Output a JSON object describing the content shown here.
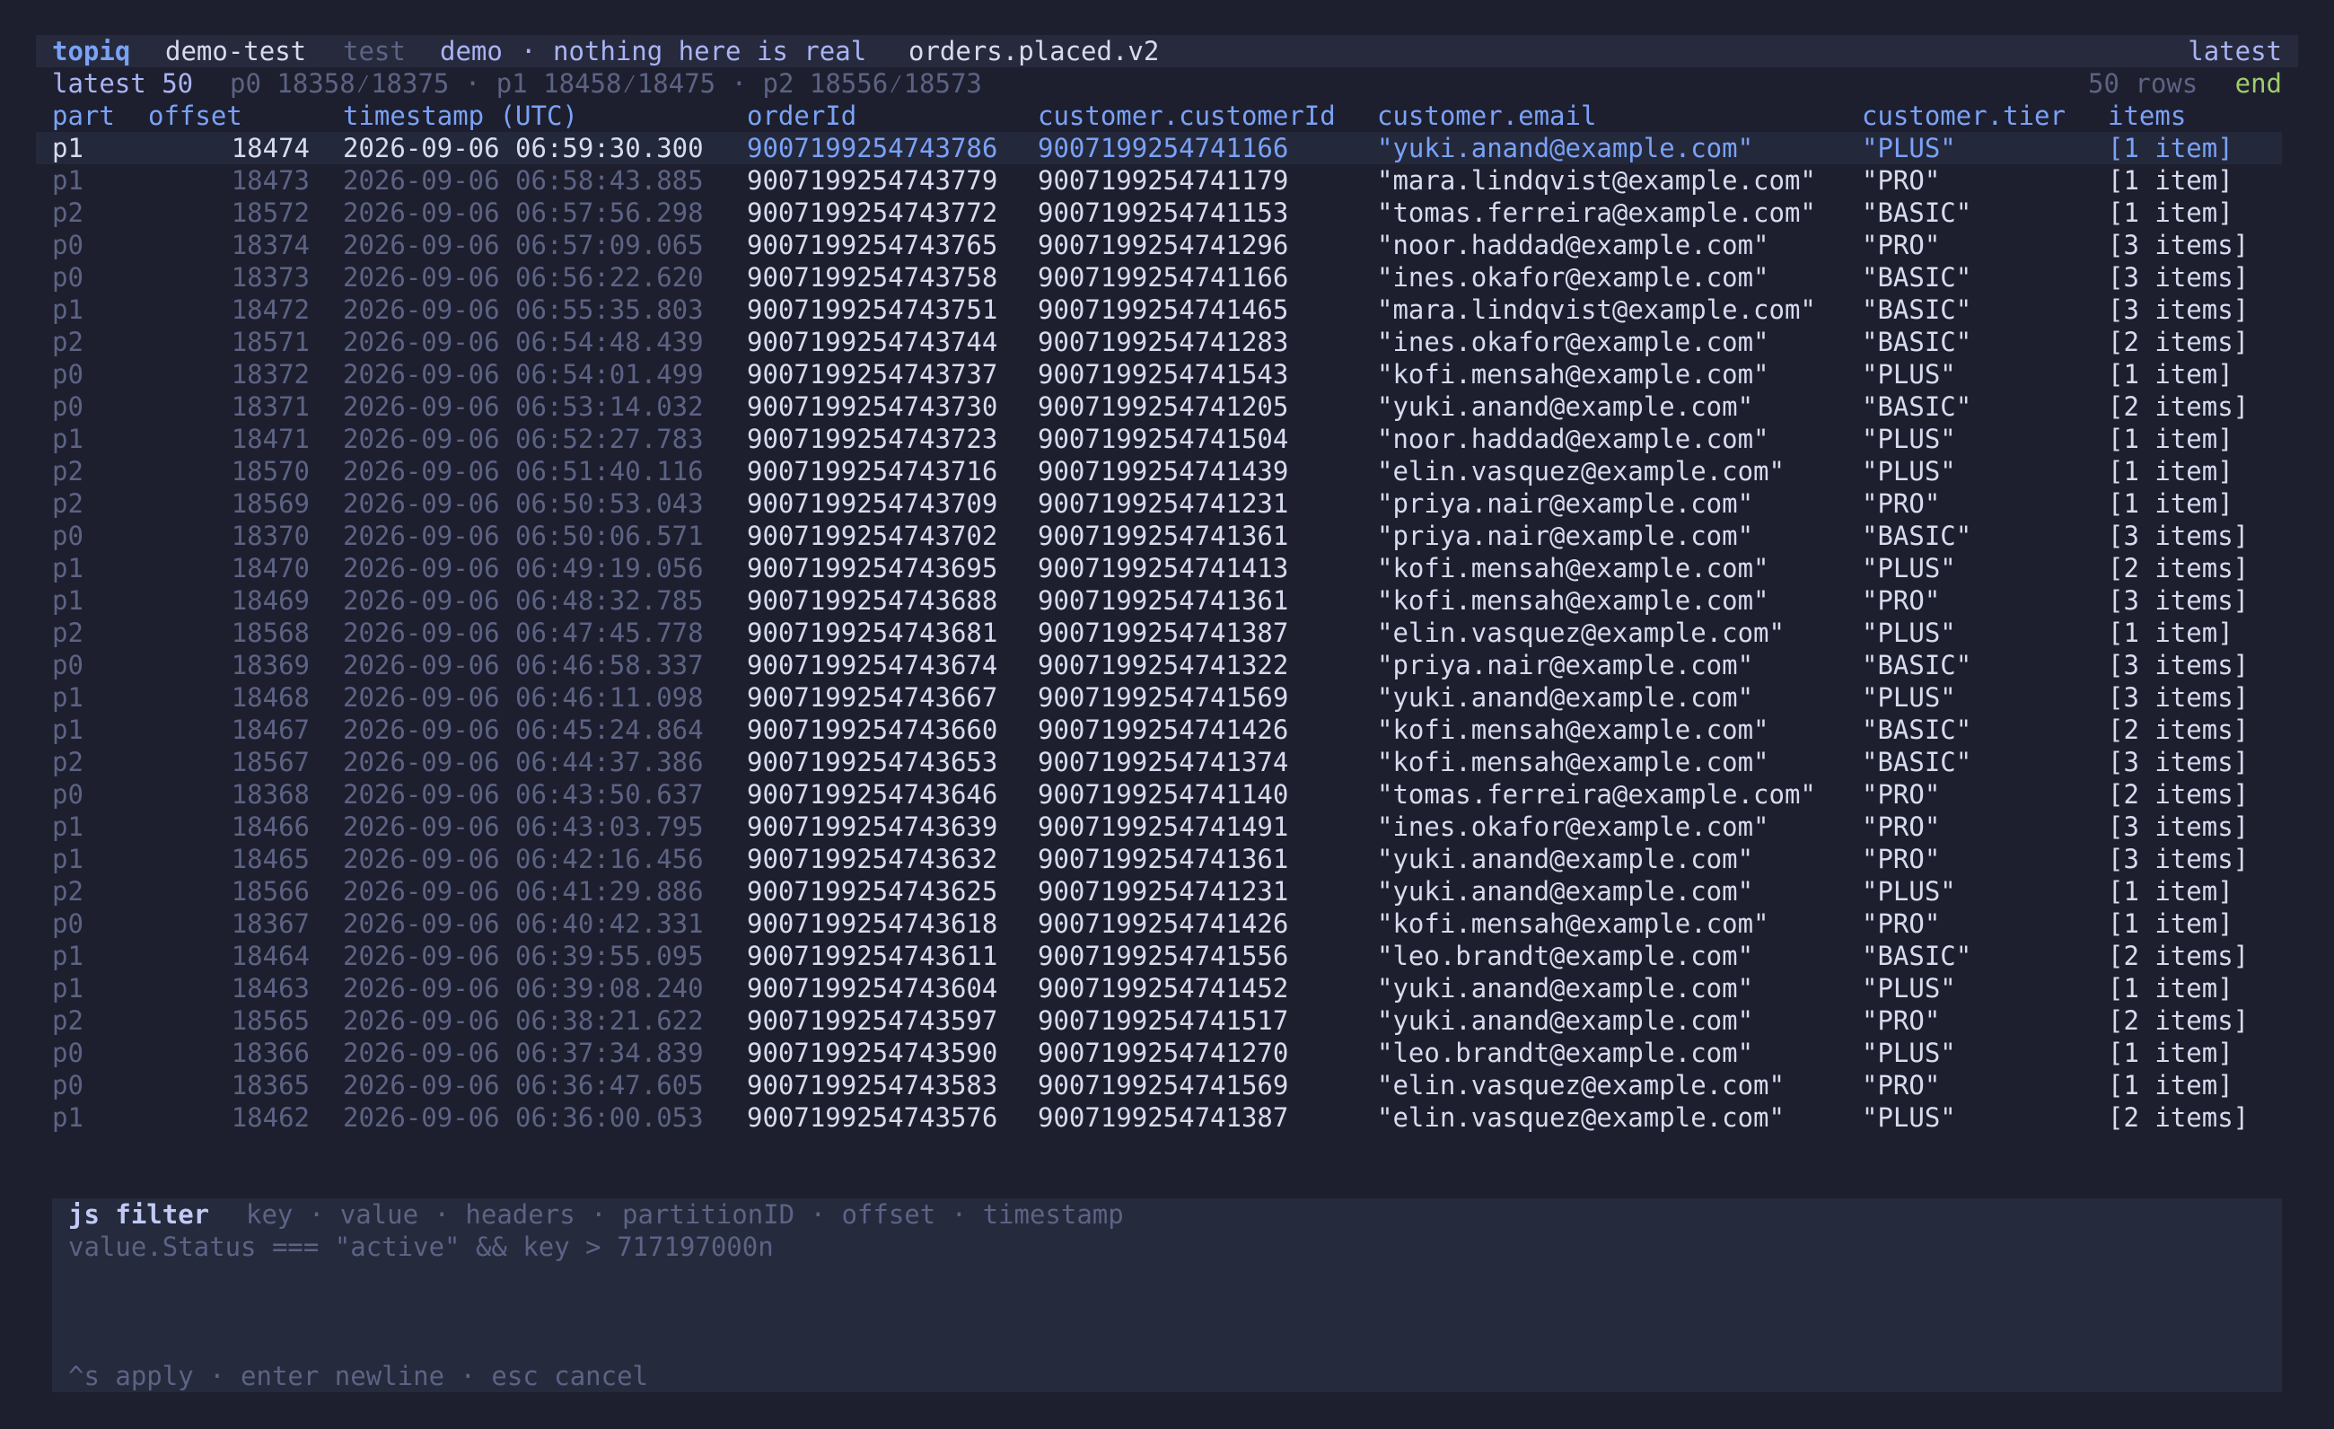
{
  "title_bar": {
    "app": "topiq",
    "cluster": "demo-test",
    "env": "test",
    "profile": "demo",
    "separator": "·",
    "note": "nothing here is real",
    "topic": "orders.placed.v2",
    "mode": "latest"
  },
  "info_bar": {
    "window": "latest 50",
    "ranges": "p0 18358⁄18375 · p1 18458⁄18475 · p2 18556⁄18573",
    "row_count": "50 rows",
    "status": "end"
  },
  "columns": {
    "part": "part",
    "offset": "offset",
    "timestamp": "timestamp (UTC)",
    "orderId": "orderId",
    "customerId": "customer.customerId",
    "email": "customer.email",
    "tier": "customer.tier",
    "items": "items"
  },
  "rows": [
    {
      "part": "p1",
      "offset": "18474",
      "ts": "2026-09-06 06:59:30.300",
      "oid": "9007199254743786",
      "cid": "9007199254741166",
      "email": "\"yuki.anand@example.com\"",
      "tier": "\"PLUS\"",
      "items": "[1 item]"
    },
    {
      "part": "p1",
      "offset": "18473",
      "ts": "2026-09-06 06:58:43.885",
      "oid": "9007199254743779",
      "cid": "9007199254741179",
      "email": "\"mara.lindqvist@example.com\"",
      "tier": "\"PRO\"",
      "items": "[1 item]"
    },
    {
      "part": "p2",
      "offset": "18572",
      "ts": "2026-09-06 06:57:56.298",
      "oid": "9007199254743772",
      "cid": "9007199254741153",
      "email": "\"tomas.ferreira@example.com\"",
      "tier": "\"BASIC\"",
      "items": "[1 item]"
    },
    {
      "part": "p0",
      "offset": "18374",
      "ts": "2026-09-06 06:57:09.065",
      "oid": "9007199254743765",
      "cid": "9007199254741296",
      "email": "\"noor.haddad@example.com\"",
      "tier": "\"PRO\"",
      "items": "[3 items]"
    },
    {
      "part": "p0",
      "offset": "18373",
      "ts": "2026-09-06 06:56:22.620",
      "oid": "9007199254743758",
      "cid": "9007199254741166",
      "email": "\"ines.okafor@example.com\"",
      "tier": "\"BASIC\"",
      "items": "[3 items]"
    },
    {
      "part": "p1",
      "offset": "18472",
      "ts": "2026-09-06 06:55:35.803",
      "oid": "9007199254743751",
      "cid": "9007199254741465",
      "email": "\"mara.lindqvist@example.com\"",
      "tier": "\"BASIC\"",
      "items": "[3 items]"
    },
    {
      "part": "p2",
      "offset": "18571",
      "ts": "2026-09-06 06:54:48.439",
      "oid": "9007199254743744",
      "cid": "9007199254741283",
      "email": "\"ines.okafor@example.com\"",
      "tier": "\"BASIC\"",
      "items": "[2 items]"
    },
    {
      "part": "p0",
      "offset": "18372",
      "ts": "2026-09-06 06:54:01.499",
      "oid": "9007199254743737",
      "cid": "9007199254741543",
      "email": "\"kofi.mensah@example.com\"",
      "tier": "\"PLUS\"",
      "items": "[1 item]"
    },
    {
      "part": "p0",
      "offset": "18371",
      "ts": "2026-09-06 06:53:14.032",
      "oid": "9007199254743730",
      "cid": "9007199254741205",
      "email": "\"yuki.anand@example.com\"",
      "tier": "\"BASIC\"",
      "items": "[2 items]"
    },
    {
      "part": "p1",
      "offset": "18471",
      "ts": "2026-09-06 06:52:27.783",
      "oid": "9007199254743723",
      "cid": "9007199254741504",
      "email": "\"noor.haddad@example.com\"",
      "tier": "\"PLUS\"",
      "items": "[1 item]"
    },
    {
      "part": "p2",
      "offset": "18570",
      "ts": "2026-09-06 06:51:40.116",
      "oid": "9007199254743716",
      "cid": "9007199254741439",
      "email": "\"elin.vasquez@example.com\"",
      "tier": "\"PLUS\"",
      "items": "[1 item]"
    },
    {
      "part": "p2",
      "offset": "18569",
      "ts": "2026-09-06 06:50:53.043",
      "oid": "9007199254743709",
      "cid": "9007199254741231",
      "email": "\"priya.nair@example.com\"",
      "tier": "\"PRO\"",
      "items": "[1 item]"
    },
    {
      "part": "p0",
      "offset": "18370",
      "ts": "2026-09-06 06:50:06.571",
      "oid": "9007199254743702",
      "cid": "9007199254741361",
      "email": "\"priya.nair@example.com\"",
      "tier": "\"BASIC\"",
      "items": "[3 items]"
    },
    {
      "part": "p1",
      "offset": "18470",
      "ts": "2026-09-06 06:49:19.056",
      "oid": "9007199254743695",
      "cid": "9007199254741413",
      "email": "\"kofi.mensah@example.com\"",
      "tier": "\"PLUS\"",
      "items": "[2 items]"
    },
    {
      "part": "p1",
      "offset": "18469",
      "ts": "2026-09-06 06:48:32.785",
      "oid": "9007199254743688",
      "cid": "9007199254741361",
      "email": "\"kofi.mensah@example.com\"",
      "tier": "\"PRO\"",
      "items": "[3 items]"
    },
    {
      "part": "p2",
      "offset": "18568",
      "ts": "2026-09-06 06:47:45.778",
      "oid": "9007199254743681",
      "cid": "9007199254741387",
      "email": "\"elin.vasquez@example.com\"",
      "tier": "\"PLUS\"",
      "items": "[1 item]"
    },
    {
      "part": "p0",
      "offset": "18369",
      "ts": "2026-09-06 06:46:58.337",
      "oid": "9007199254743674",
      "cid": "9007199254741322",
      "email": "\"priya.nair@example.com\"",
      "tier": "\"BASIC\"",
      "items": "[3 items]"
    },
    {
      "part": "p1",
      "offset": "18468",
      "ts": "2026-09-06 06:46:11.098",
      "oid": "9007199254743667",
      "cid": "9007199254741569",
      "email": "\"yuki.anand@example.com\"",
      "tier": "\"PLUS\"",
      "items": "[3 items]"
    },
    {
      "part": "p1",
      "offset": "18467",
      "ts": "2026-09-06 06:45:24.864",
      "oid": "9007199254743660",
      "cid": "9007199254741426",
      "email": "\"kofi.mensah@example.com\"",
      "tier": "\"BASIC\"",
      "items": "[2 items]"
    },
    {
      "part": "p2",
      "offset": "18567",
      "ts": "2026-09-06 06:44:37.386",
      "oid": "9007199254743653",
      "cid": "9007199254741374",
      "email": "\"kofi.mensah@example.com\"",
      "tier": "\"BASIC\"",
      "items": "[3 items]"
    },
    {
      "part": "p0",
      "offset": "18368",
      "ts": "2026-09-06 06:43:50.637",
      "oid": "9007199254743646",
      "cid": "9007199254741140",
      "email": "\"tomas.ferreira@example.com\"",
      "tier": "\"PRO\"",
      "items": "[2 items]"
    },
    {
      "part": "p1",
      "offset": "18466",
      "ts": "2026-09-06 06:43:03.795",
      "oid": "9007199254743639",
      "cid": "9007199254741491",
      "email": "\"ines.okafor@example.com\"",
      "tier": "\"PRO\"",
      "items": "[3 items]"
    },
    {
      "part": "p1",
      "offset": "18465",
      "ts": "2026-09-06 06:42:16.456",
      "oid": "9007199254743632",
      "cid": "9007199254741361",
      "email": "\"yuki.anand@example.com\"",
      "tier": "\"PRO\"",
      "items": "[3 items]"
    },
    {
      "part": "p2",
      "offset": "18566",
      "ts": "2026-09-06 06:41:29.886",
      "oid": "9007199254743625",
      "cid": "9007199254741231",
      "email": "\"yuki.anand@example.com\"",
      "tier": "\"PLUS\"",
      "items": "[1 item]"
    },
    {
      "part": "p0",
      "offset": "18367",
      "ts": "2026-09-06 06:40:42.331",
      "oid": "9007199254743618",
      "cid": "9007199254741426",
      "email": "\"kofi.mensah@example.com\"",
      "tier": "\"PRO\"",
      "items": "[1 item]"
    },
    {
      "part": "p1",
      "offset": "18464",
      "ts": "2026-09-06 06:39:55.095",
      "oid": "9007199254743611",
      "cid": "9007199254741556",
      "email": "\"leo.brandt@example.com\"",
      "tier": "\"BASIC\"",
      "items": "[2 items]"
    },
    {
      "part": "p1",
      "offset": "18463",
      "ts": "2026-09-06 06:39:08.240",
      "oid": "9007199254743604",
      "cid": "9007199254741452",
      "email": "\"yuki.anand@example.com\"",
      "tier": "\"PLUS\"",
      "items": "[1 item]"
    },
    {
      "part": "p2",
      "offset": "18565",
      "ts": "2026-09-06 06:38:21.622",
      "oid": "9007199254743597",
      "cid": "9007199254741517",
      "email": "\"yuki.anand@example.com\"",
      "tier": "\"PRO\"",
      "items": "[2 items]"
    },
    {
      "part": "p0",
      "offset": "18366",
      "ts": "2026-09-06 06:37:34.839",
      "oid": "9007199254743590",
      "cid": "9007199254741270",
      "email": "\"leo.brandt@example.com\"",
      "tier": "\"PLUS\"",
      "items": "[1 item]"
    },
    {
      "part": "p0",
      "offset": "18365",
      "ts": "2026-09-06 06:36:47.605",
      "oid": "9007199254743583",
      "cid": "9007199254741569",
      "email": "\"elin.vasquez@example.com\"",
      "tier": "\"PRO\"",
      "items": "[1 item]"
    },
    {
      "part": "p1",
      "offset": "18462",
      "ts": "2026-09-06 06:36:00.053",
      "oid": "9007199254743576",
      "cid": "9007199254741387",
      "email": "\"elin.vasquez@example.com\"",
      "tier": "\"PLUS\"",
      "items": "[2 items]"
    }
  ],
  "filter": {
    "title": "js filter",
    "fields_hint": "key · value · headers · partitionID · offset · timestamp",
    "expression": "value.Status === \"active\" && key > 717197000n",
    "keys_hint": "^s apply · enter newline · esc cancel"
  },
  "colors": {
    "background": "#1e1f2e",
    "accent": "#7aa2f7",
    "muted": "#5c6384",
    "status_end": "#9ece6a"
  }
}
